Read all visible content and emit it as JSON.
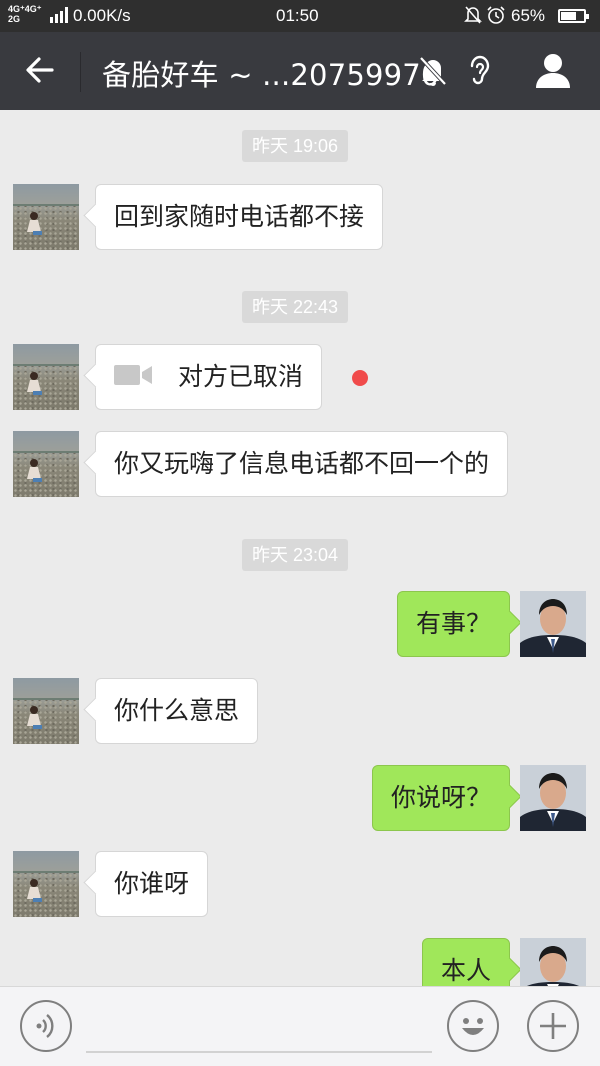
{
  "status_bar": {
    "network_top": "4G⁺4G⁺",
    "network_bottom": "2G",
    "speed": "0.00K/s",
    "time": "01:50",
    "battery_percent": "65%",
    "battery_level": 0.62
  },
  "header": {
    "title": "备胎好车 ~ ...20759970",
    "back_icon": "arrow-left-icon",
    "mute_icon": "bell-off-icon",
    "earpiece_icon": "ear-icon",
    "profile_icon": "person-icon"
  },
  "messages": [
    {
      "type": "time",
      "text": "昨天 19:06"
    },
    {
      "type": "in",
      "text": "回到家随时电话都不接"
    },
    {
      "type": "time",
      "text": "昨天 22:43"
    },
    {
      "type": "call",
      "text": "对方已取消",
      "icon": "video-camera-icon",
      "unread": true
    },
    {
      "type": "in",
      "text": "你又玩嗨了信息电话都不回一个的"
    },
    {
      "type": "time",
      "text": "昨天 23:04"
    },
    {
      "type": "out",
      "text": "有事？"
    },
    {
      "type": "in",
      "text": "你什么意思"
    },
    {
      "type": "out",
      "text": "你说呀？"
    },
    {
      "type": "in",
      "text": "你谁呀"
    },
    {
      "type": "out",
      "text": "本人"
    }
  ],
  "input_bar": {
    "voice_icon": "voice-icon",
    "emoji_icon": "smiley-icon",
    "more_icon": "plus-icon"
  },
  "colors": {
    "header_bg": "#393a3f",
    "chat_bg": "#ebebeb",
    "outgoing_bubble": "#a0e75a",
    "unread_dot": "#f04b4b"
  }
}
